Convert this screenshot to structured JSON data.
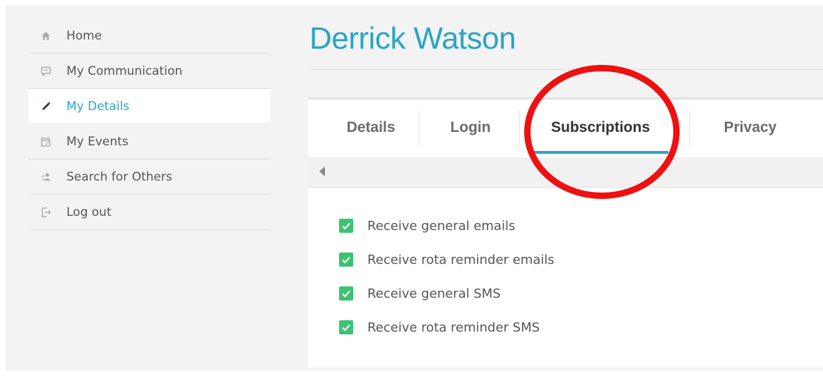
{
  "sidebar": {
    "items": [
      {
        "label": "Home",
        "icon": "home-icon",
        "active": false
      },
      {
        "label": "My Communication",
        "icon": "chat-icon",
        "active": false
      },
      {
        "label": "My Details",
        "icon": "pencil-icon",
        "active": true
      },
      {
        "label": "My Events",
        "icon": "calendar-icon",
        "active": false
      },
      {
        "label": "Search for Others",
        "icon": "users-icon",
        "active": false
      },
      {
        "label": "Log out",
        "icon": "logout-icon",
        "active": false
      }
    ]
  },
  "page": {
    "title": "Derrick Watson"
  },
  "tabs": [
    {
      "label": "Details",
      "active": false
    },
    {
      "label": "Login",
      "active": false
    },
    {
      "label": "Subscriptions",
      "active": true
    },
    {
      "label": "Privacy",
      "active": false
    }
  ],
  "subscriptions": [
    {
      "label": "Receive general emails",
      "checked": true
    },
    {
      "label": "Receive rota reminder emails",
      "checked": true
    },
    {
      "label": "Receive general SMS",
      "checked": true
    },
    {
      "label": "Receive rota reminder SMS",
      "checked": true
    }
  ],
  "colors": {
    "accent": "#29a5c3",
    "check": "#3cc36f",
    "highlight": "#ee1111"
  }
}
